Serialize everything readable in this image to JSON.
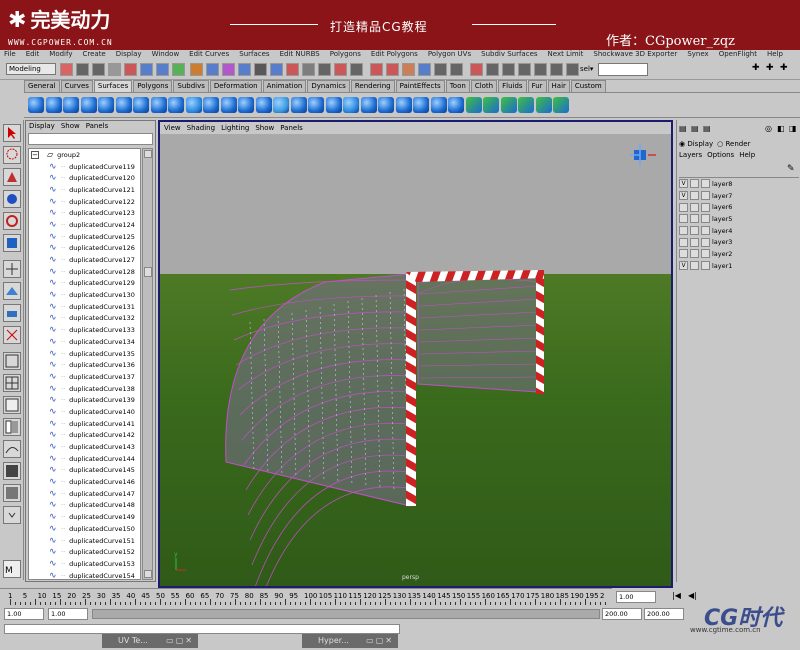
{
  "banner": {
    "logo": "完美动力",
    "url": "WWW.CGPOWER.COM.CN",
    "title": "打造精品CG教程",
    "author": "作者：CGpower_zqz"
  },
  "menu": [
    "File",
    "Edit",
    "Modify",
    "Create",
    "Display",
    "Window",
    "Edit Curves",
    "Surfaces",
    "Edit NURBS",
    "Polygons",
    "Edit Polygons",
    "Polygon UVs",
    "Subdiv Surfaces",
    "Next Limit",
    "Shockwave 3D Exporter",
    "Synex",
    "OpenFlight",
    "Help"
  ],
  "status": {
    "mode": "Modeling",
    "sel_label": "sel▾"
  },
  "shelf_tabs": [
    "General",
    "Curves",
    "Surfaces",
    "Polygons",
    "Subdivs",
    "Deformation",
    "Animation",
    "Dynamics",
    "Rendering",
    "PaintEffects",
    "Toon",
    "Cloth",
    "Fluids",
    "Fur",
    "Hair",
    "Custom"
  ],
  "shelf_active": "Surfaces",
  "outliner": {
    "menu": [
      "Display",
      "Show",
      "Panels"
    ],
    "group": "group2",
    "items": [
      "duplicatedCurve119",
      "duplicatedCurve120",
      "duplicatedCurve121",
      "duplicatedCurve122",
      "duplicatedCurve123",
      "duplicatedCurve124",
      "duplicatedCurve125",
      "duplicatedCurve126",
      "duplicatedCurve127",
      "duplicatedCurve128",
      "duplicatedCurve129",
      "duplicatedCurve130",
      "duplicatedCurve131",
      "duplicatedCurve132",
      "duplicatedCurve133",
      "duplicatedCurve134",
      "duplicatedCurve135",
      "duplicatedCurve136",
      "duplicatedCurve137",
      "duplicatedCurve138",
      "duplicatedCurve139",
      "duplicatedCurve140",
      "duplicatedCurve141",
      "duplicatedCurve142",
      "duplicatedCurve143",
      "duplicatedCurve144",
      "duplicatedCurve145",
      "duplicatedCurve146",
      "duplicatedCurve147",
      "duplicatedCurve148",
      "duplicatedCurve149",
      "duplicatedCurve150",
      "duplicatedCurve151",
      "duplicatedCurve152",
      "duplicatedCurve153",
      "duplicatedCurve154"
    ]
  },
  "viewport": {
    "menu": [
      "View",
      "Shading",
      "Lighting",
      "Show",
      "Panels"
    ],
    "camera": "persp",
    "sky_color": "#a9a9aa",
    "ground_color": "#3f6f1e",
    "post_colors": [
      "#cc2222",
      "#ffffff"
    ],
    "net_color": "#c050c8"
  },
  "channel": {
    "radio_display": "Display",
    "radio_render": "Render",
    "layer_menu": [
      "Layers",
      "Options",
      "Help"
    ],
    "layers": [
      {
        "name": "layer8",
        "visible": "V"
      },
      {
        "name": "layer7",
        "visible": "V"
      },
      {
        "name": "layer6",
        "visible": ""
      },
      {
        "name": "layer5",
        "visible": ""
      },
      {
        "name": "layer4",
        "visible": ""
      },
      {
        "name": "layer3",
        "visible": ""
      },
      {
        "name": "layer2",
        "visible": ""
      },
      {
        "name": "layer1",
        "visible": "V"
      }
    ]
  },
  "timeline": {
    "ticks": [
      "1",
      "5",
      "10",
      "15",
      "20",
      "25",
      "30",
      "35",
      "40",
      "45",
      "50",
      "55",
      "60",
      "65",
      "70",
      "75",
      "80",
      "85",
      "90",
      "95",
      "100",
      "105",
      "110",
      "115",
      "120",
      "125",
      "130",
      "135",
      "140",
      "145",
      "150",
      "155",
      "160",
      "165",
      "170",
      "175",
      "180",
      "185",
      "190",
      "195",
      "2"
    ],
    "current": "1.00"
  },
  "range": {
    "start": "1.00",
    "start2": "1.00",
    "end": "200.00",
    "end2": "200.00"
  },
  "windows": [
    {
      "title": "UV Te..."
    },
    {
      "title": "Hyper..."
    }
  ],
  "watermark": {
    "text": "CG时代",
    "url": "www.cgtime.com.cn"
  }
}
